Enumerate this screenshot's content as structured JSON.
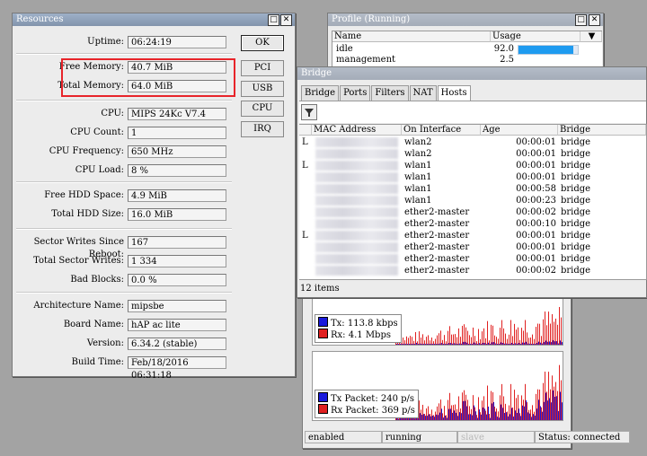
{
  "resources": {
    "title": "Resources",
    "rows": [
      {
        "label": "Uptime:",
        "value": "06:24:19"
      },
      {
        "label": "Free Memory:",
        "value": "40.7 MiB"
      },
      {
        "label": "Total Memory:",
        "value": "64.0 MiB"
      },
      {
        "label": "CPU:",
        "value": "MIPS 24Kc V7.4"
      },
      {
        "label": "CPU Count:",
        "value": "1"
      },
      {
        "label": "CPU Frequency:",
        "value": "650 MHz"
      },
      {
        "label": "CPU Load:",
        "value": "8 %"
      },
      {
        "label": "Free HDD Space:",
        "value": "4.9 MiB"
      },
      {
        "label": "Total HDD Size:",
        "value": "16.0 MiB"
      },
      {
        "label": "Sector Writes Since Reboot:",
        "value": "167"
      },
      {
        "label": "Total Sector Writes:",
        "value": "1 334"
      },
      {
        "label": "Bad Blocks:",
        "value": "0.0 %"
      },
      {
        "label": "Architecture Name:",
        "value": "mipsbe"
      },
      {
        "label": "Board Name:",
        "value": "hAP ac lite"
      },
      {
        "label": "Version:",
        "value": "6.34.2 (stable)"
      },
      {
        "label": "Build Time:",
        "value": "Feb/18/2016 06:31:18"
      }
    ],
    "buttons": [
      "OK",
      "PCI",
      "USB",
      "CPU",
      "IRQ"
    ]
  },
  "profile": {
    "title": "Profile (Running)",
    "columns": [
      "Name",
      "Usage"
    ],
    "rows": [
      {
        "name": "idle",
        "usage": "92.0",
        "fill": 0.92
      },
      {
        "name": "management",
        "usage": "2.5",
        "fill": 0.025
      }
    ]
  },
  "bridge": {
    "title": "Bridge",
    "tabs": [
      "Bridge",
      "Ports",
      "Filters",
      "NAT",
      "Hosts"
    ],
    "active_tab": "Hosts",
    "columns": [
      "MAC Address",
      "On Interface",
      "Age",
      "Bridge"
    ],
    "rows": [
      {
        "flag": "L",
        "iface": "wlan2",
        "age": "00:00:01",
        "bridge": "bridge"
      },
      {
        "flag": "",
        "iface": "wlan2",
        "age": "00:00:01",
        "bridge": "bridge"
      },
      {
        "flag": "L",
        "iface": "wlan1",
        "age": "00:00:01",
        "bridge": "bridge"
      },
      {
        "flag": "",
        "iface": "wlan1",
        "age": "00:00:01",
        "bridge": "bridge"
      },
      {
        "flag": "",
        "iface": "wlan1",
        "age": "00:00:58",
        "bridge": "bridge"
      },
      {
        "flag": "",
        "iface": "wlan1",
        "age": "00:00:23",
        "bridge": "bridge"
      },
      {
        "flag": "",
        "iface": "ether2-master",
        "age": "00:00:02",
        "bridge": "bridge"
      },
      {
        "flag": "",
        "iface": "ether2-master",
        "age": "00:00:10",
        "bridge": "bridge"
      },
      {
        "flag": "L",
        "iface": "ether2-master",
        "age": "00:00:01",
        "bridge": "bridge"
      },
      {
        "flag": "",
        "iface": "ether2-master",
        "age": "00:00:01",
        "bridge": "bridge"
      },
      {
        "flag": "",
        "iface": "ether2-master",
        "age": "00:00:01",
        "bridge": "bridge"
      },
      {
        "flag": "",
        "iface": "ether2-master",
        "age": "00:00:02",
        "bridge": "bridge"
      }
    ],
    "item_count": "12 items"
  },
  "traffic": {
    "tx_label": "Tx:",
    "tx_value": "113.8 kbps",
    "rx_label": "Rx:",
    "rx_value": "4.1 Mbps",
    "txp_label": "Tx Packet:",
    "txp_value": "240 p/s",
    "rxp_label": "Rx Packet:",
    "rxp_value": "369 p/s",
    "tx_color": "#1a1adc",
    "rx_color": "#e02020"
  },
  "status_bar": {
    "state": "enabled",
    "run": "running",
    "slave": "slave",
    "status": "Status: connected"
  },
  "colors": {
    "highlight": "#e8242a",
    "usage_bar": "#1e9bf0"
  }
}
